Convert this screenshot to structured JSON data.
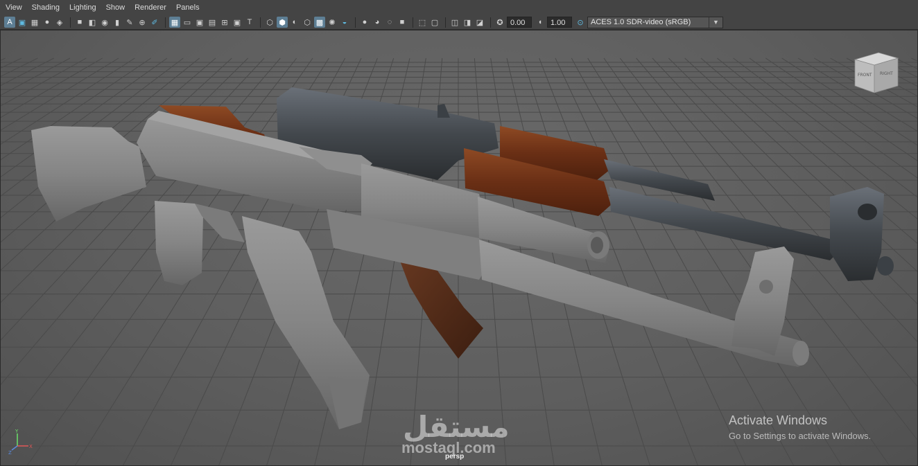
{
  "menu": [
    "View",
    "Shading",
    "Lighting",
    "Show",
    "Renderer",
    "Panels"
  ],
  "toolbar": {
    "exposure": "0.00",
    "gamma": "1.00",
    "color_space": "ACES 1.0 SDR-video (sRGB)"
  },
  "viewcube": {
    "front": "FRONT",
    "right": "RIGHT"
  },
  "viewport": {
    "camera": "persp"
  },
  "activation": {
    "title": "Activate Windows",
    "subtitle": "Go to Settings to activate Windows."
  },
  "watermark": {
    "arabic": "مستقل",
    "latin": "mostaql.com"
  },
  "axis": {
    "x": "X",
    "y": "Y",
    "z": "Z"
  },
  "colors": {
    "accent": "#5fb9e0",
    "wood": "#7a3a1c",
    "metal": "#4c5156",
    "clay": "#8a8a8a"
  }
}
